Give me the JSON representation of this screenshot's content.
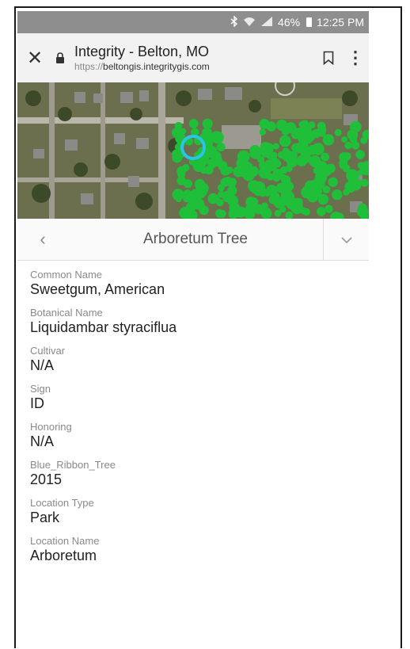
{
  "statusbar": {
    "bluetooth_icon": "bluetooth-icon",
    "wifi_icon": "wifi-icon",
    "signal_icon": "signal-icon",
    "battery_percent": "46%",
    "time": "12:25 PM"
  },
  "browser": {
    "close_icon": "close-icon",
    "lock_icon": "lock-icon",
    "page_title": "Integrity - Belton, MO",
    "url_protocol": "https://",
    "url_host": "beltongis.integritygis.com",
    "bookmark_icon": "bookmark-icon",
    "menu_icon": "more-vert-icon"
  },
  "map": {
    "highlight_color": "#29c5e6",
    "tree_color": "#1fbf3a"
  },
  "feature": {
    "prev_icon": "chevron-left-icon",
    "title": "Arboretum Tree",
    "expand_icon": "chevron-down-icon"
  },
  "fields": [
    {
      "label": "Common Name",
      "value": "Sweetgum, American"
    },
    {
      "label": "Botanical Name",
      "value": "Liquidambar styraciflua"
    },
    {
      "label": "Cultivar",
      "value": "N/A"
    },
    {
      "label": "Sign",
      "value": "ID"
    },
    {
      "label": "Honoring",
      "value": "N/A"
    },
    {
      "label": "Blue_Ribbon_Tree",
      "value": "2015"
    },
    {
      "label": "Location Type",
      "value": "Park"
    },
    {
      "label": "Location Name",
      "value": "Arboretum"
    }
  ]
}
